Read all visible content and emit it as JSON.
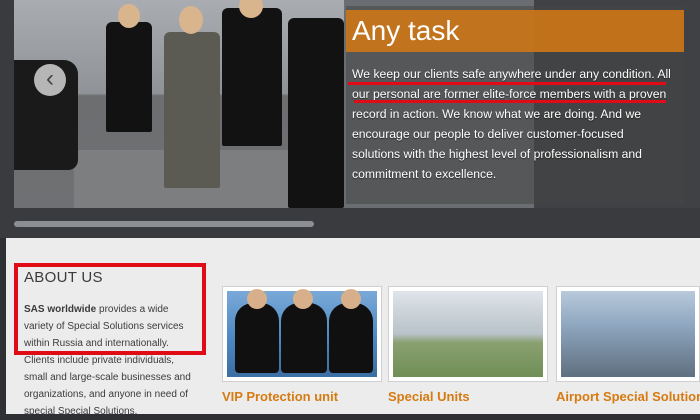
{
  "hero": {
    "title": "Any task",
    "text": "We keep our clients safe anywhere under any condition. All our personal are former elite-force members with a proven record in action. We know what we are doing. And we encourage our people to deliver customer-focused solutions with the highest level of professionalism and commitment to excellence.",
    "prev_icon": "chevron-left-icon",
    "accent_color": "#d67a12",
    "highlight_color": "#e10b17"
  },
  "about": {
    "heading": "ABOUT US",
    "brand": "SAS worldwide",
    "text": " provides a wide variety of Special Solutions services within Russia and internationally. Clients include private individuals, small and large-scale businesses and organizations, and anyone in need of special Special Solutions."
  },
  "services": [
    {
      "label": "VIP Protection unit"
    },
    {
      "label": "Special Units"
    },
    {
      "label": "Airport Special Solutions"
    }
  ]
}
